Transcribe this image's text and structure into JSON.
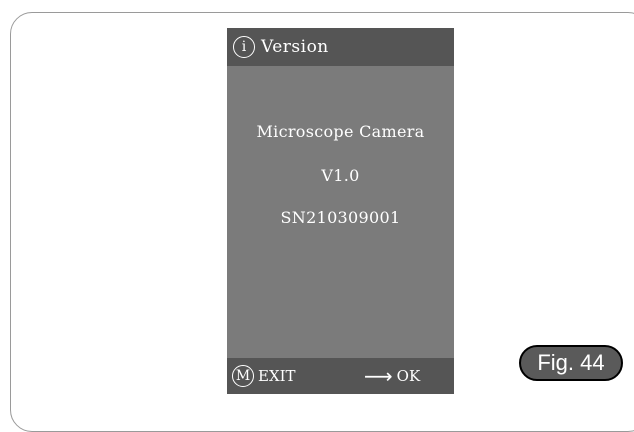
{
  "screen": {
    "title": {
      "icon": "info-circle-icon",
      "icon_glyph": "i",
      "label": "Version"
    },
    "info": {
      "product": "Microscope Camera",
      "version": "V1.0",
      "serial": "SN210309001"
    },
    "footer": {
      "exit_icon": "m-circle-icon",
      "exit_icon_glyph": "M",
      "exit_label": "EXIT",
      "ok_icon": "right-arrow-icon",
      "ok_icon_glyph": "⟶",
      "ok_label": "OK"
    }
  },
  "figure_label": "Fig. 44",
  "colors": {
    "screen_background": "#7b7b7b",
    "bar_background": "#555555",
    "text": "#ffffff",
    "badge_background": "#5a5a5a",
    "badge_border": "#000000",
    "frame_border": "#9a9a9a"
  }
}
